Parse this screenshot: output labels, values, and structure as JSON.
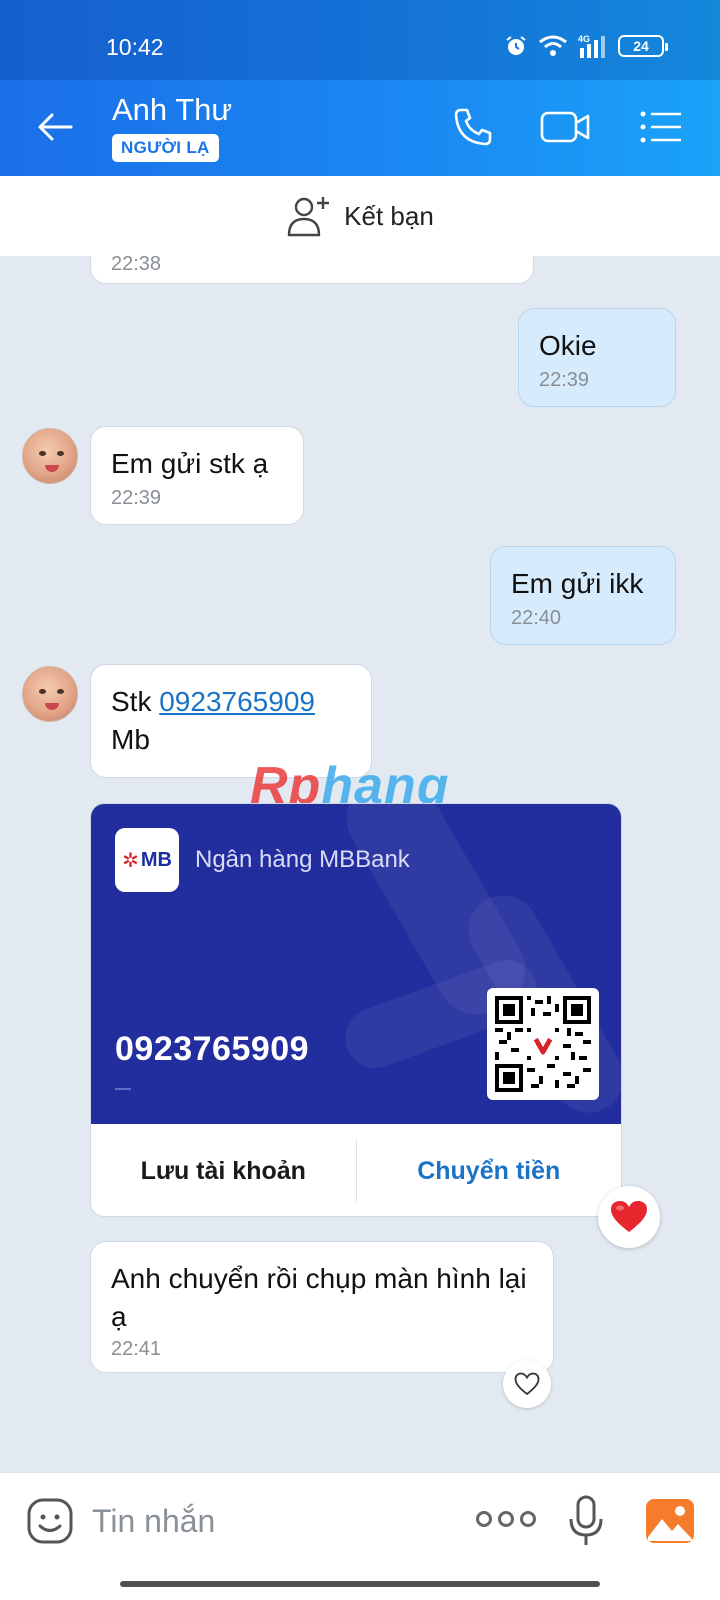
{
  "status_bar": {
    "time": "10:42",
    "network": "4G",
    "battery": "24"
  },
  "header": {
    "title": "Anh Thư",
    "badge": "NGƯỜI LẠ"
  },
  "friend_bar": {
    "label": "Kết bạn"
  },
  "messages": [
    {
      "side": "them",
      "text": "",
      "time": "22:38"
    },
    {
      "side": "me",
      "text": "Okie",
      "time": "22:39"
    },
    {
      "side": "them",
      "text": "Em gửi stk ạ",
      "time": "22:39"
    },
    {
      "side": "me",
      "text": "Em gửi ikk",
      "time": "22:40"
    },
    {
      "side": "them",
      "text_prefix": "Stk ",
      "link": "0923765909",
      "text_suffix": "Mb"
    },
    {
      "side": "them",
      "text": "Anh chuyển rồi chụp màn hình lại ạ",
      "time": "22:41"
    }
  ],
  "bank_card": {
    "bank_logo_text": "MB",
    "bank_name": "Ngân hàng MBBank",
    "account_number": "0923765909",
    "account_holder": "—",
    "save_label": "Lưu tài khoản",
    "transfer_label": "Chuyển tiền",
    "background_color": "#232e9e",
    "transfer_color": "#1b73c8"
  },
  "reactions": {
    "card": "heart-filled",
    "last_message": "heart-outline"
  },
  "watermark": {
    "part1": "Rp",
    "part2": "hang"
  },
  "composer": {
    "placeholder": "Tin nhắn"
  },
  "colors": {
    "header": "#1b6fe8",
    "chat_background": "#e2e9f1",
    "my_bubble": "#d6ecfc",
    "link": "#1b73c8",
    "heart": "#e8262e"
  }
}
